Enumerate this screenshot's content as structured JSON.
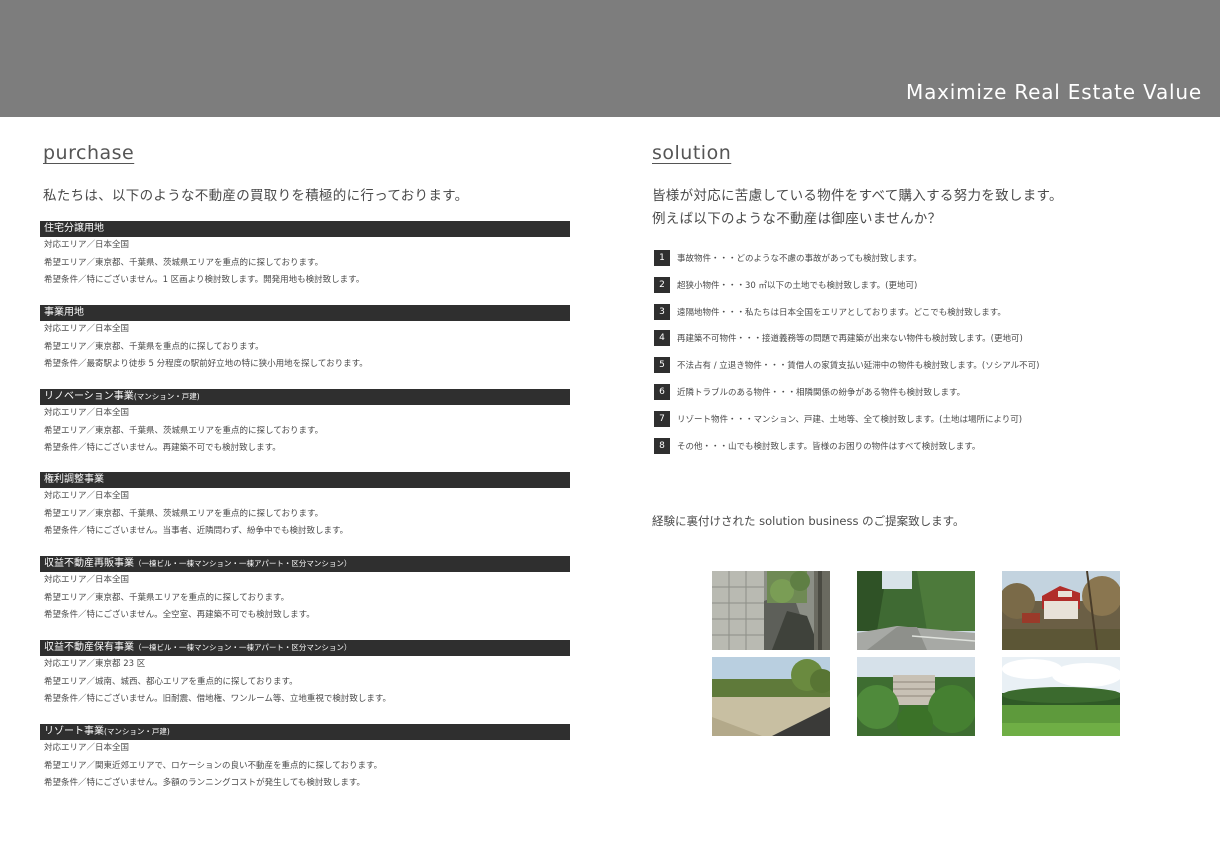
{
  "banner": {
    "title": "Maximize Real Estate Value"
  },
  "purchase": {
    "title": "purchase",
    "lead": "私たちは、以下のような不動産の買取りを積極的に行っております。",
    "categories": [
      {
        "title": "住宅分譲用地",
        "sub": "",
        "lines": [
          "対応エリア／日本全国",
          "希望エリア／東京都、千葉県、茨城県エリアを重点的に探しております。",
          "希望条件／特にございません。1 区画より検討致します。開発用地も検討致します。"
        ]
      },
      {
        "title": "事業用地",
        "sub": "",
        "lines": [
          "対応エリア／日本全国",
          "希望エリア／東京都、千葉県を重点的に探しております。",
          "希望条件／最寄駅より徒歩 5 分程度の駅前好立地の特に狭小用地を探しております。"
        ]
      },
      {
        "title": "リノベーション事業",
        "sub": "(マンション・戸建)",
        "lines": [
          "対応エリア／日本全国",
          "希望エリア／東京都、千葉県、茨城県エリアを重点的に探しております。",
          "希望条件／特にございません。再建築不可でも検討致します。"
        ]
      },
      {
        "title": "権利調整事業",
        "sub": "",
        "lines": [
          "対応エリア／日本全国",
          "希望エリア／東京都、千葉県、茨城県エリアを重点的に探しております。",
          "希望条件／特にございません。当事者、近隣問わず、紛争中でも検討致します。"
        ]
      },
      {
        "title": "収益不動産再販事業",
        "sub": "（一棟ビル・一棟マンション・一棟アパート・区分マンション）",
        "lines": [
          "対応エリア／日本全国",
          "希望エリア／東京都、千葉県エリアを重点的に探しております。",
          "希望条件／特にございません。全空室、再建築不可でも検討致します。"
        ]
      },
      {
        "title": "収益不動産保有事業",
        "sub": "（一棟ビル・一棟マンション・一棟アパート・区分マンション）",
        "lines": [
          "対応エリア／東京都 23 区",
          "希望エリア／城南、城西、都心エリアを重点的に探しております。",
          "希望条件／特にございません。旧耐震、借地権、ワンルーム等、立地重視で検討致します。"
        ]
      },
      {
        "title": "リゾート事業",
        "sub": "(マンション・戸建)",
        "lines": [
          "対応エリア／日本全国",
          "希望エリア／関東近郊エリアで、ロケーションの良い不動産を重点的に探しております。",
          "希望条件／特にございません。多額のランニングコストが発生しても検討致します。"
        ]
      }
    ]
  },
  "solution": {
    "title": "solution",
    "lead1": "皆様が対応に苦慮している物件をすべて購入する努力を致します。",
    "lead2": "例えば以下のような不動産は御座いませんか？",
    "items": [
      {
        "num": "1",
        "text": "事故物件・・・どのような不慮の事故があっても検討致します。"
      },
      {
        "num": "2",
        "text": "超狭小物件・・・30 ㎡以下の土地でも検討致します。(更地可)"
      },
      {
        "num": "3",
        "text": "遠隔地物件・・・私たちは日本全国をエリアとしております。どこでも検討致します。"
      },
      {
        "num": "4",
        "text": "再建築不可物件・・・接道義務等の問題で再建築が出来ない物件も検討致します。(更地可)"
      },
      {
        "num": "5",
        "text": "不法占有 / 立退き物件・・・賃借人の家賃支払い延滞中の物件も検討致します。(ソシアル不可)"
      },
      {
        "num": "6",
        "text": "近隣トラブルのある物件・・・相隣関係の紛争がある物件も検討致します。"
      },
      {
        "num": "7",
        "text": "リゾート物件・・・マンション、戸建、土地等、全て検討致します。(土地は場所により可)"
      },
      {
        "num": "8",
        "text": "その他・・・山でも検討致します。皆様のお困りの物件はすべて検討致します。"
      }
    ],
    "closing": "経験に裏付けされた solution business のご提案致します。"
  },
  "photos": [
    {
      "name": "alley-photo"
    },
    {
      "name": "forest-road-photo"
    },
    {
      "name": "hillside-house-photo"
    },
    {
      "name": "vacant-lot-photo"
    },
    {
      "name": "resort-building-photo"
    },
    {
      "name": "rural-field-photo"
    }
  ]
}
